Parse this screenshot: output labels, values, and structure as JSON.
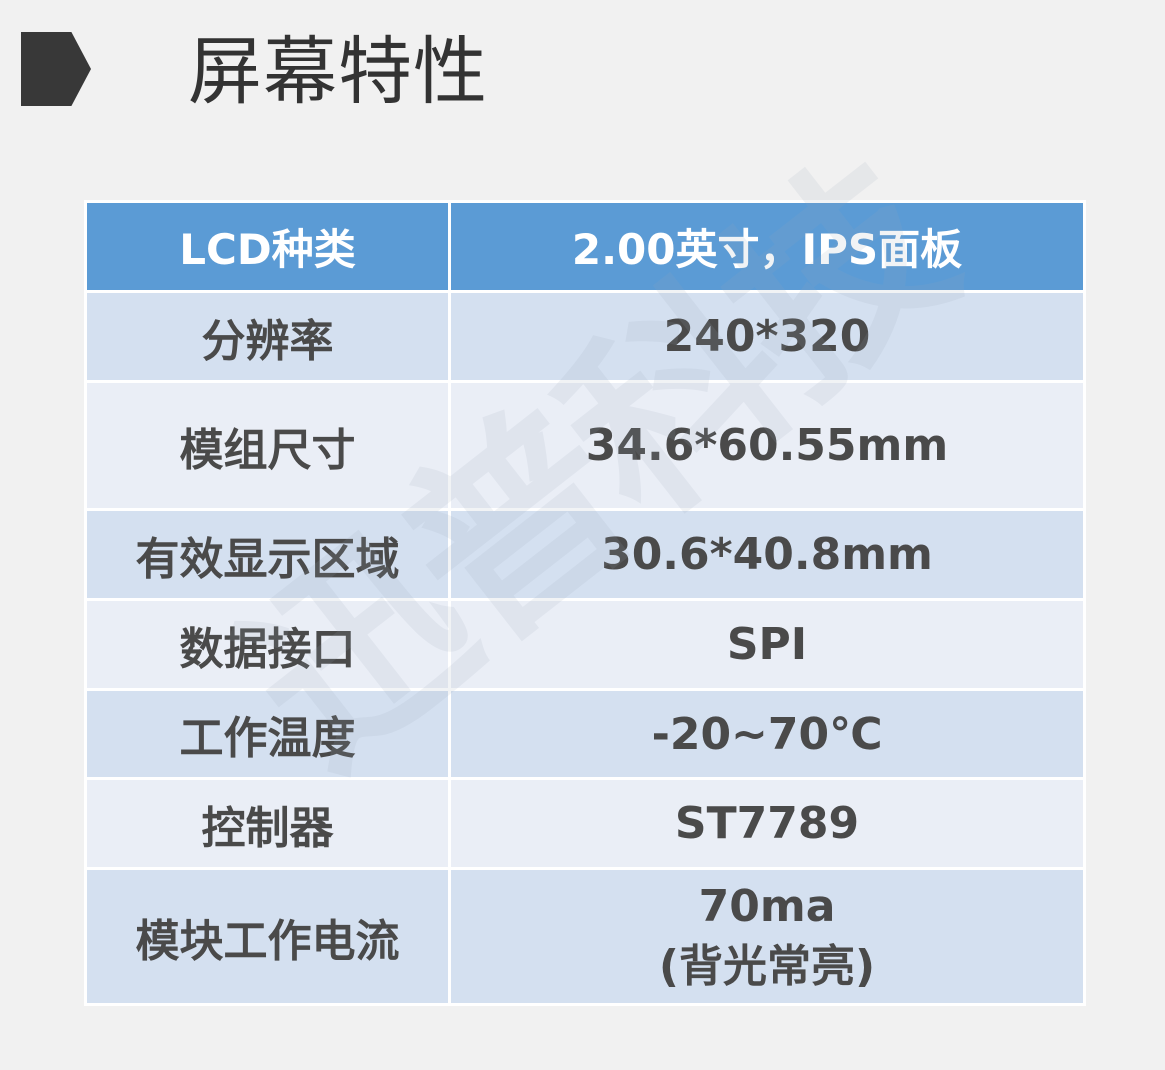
{
  "page": {
    "title": "屏幕特性"
  },
  "table": {
    "header": {
      "label": "LCD种类",
      "value": "2.00英寸，IPS面板"
    },
    "rows": [
      {
        "label": "分辨率",
        "value": "240*320"
      },
      {
        "label": "模组尺寸",
        "value": "34.6*60.55mm"
      },
      {
        "label": "有效显示区域",
        "value": "30.6*40.8mm"
      },
      {
        "label": "数据接口",
        "value": "SPI"
      },
      {
        "label": "工作温度",
        "value": "-20~70℃"
      },
      {
        "label": "控制器",
        "value": "ST7789"
      },
      {
        "label": "模块工作电流",
        "value_line1": "70ma",
        "value_line2": "(背光常亮)"
      }
    ]
  },
  "watermark": {
    "text": "迅普科技"
  },
  "colors": {
    "background": "#f1f1f1",
    "header_bg": "#5b9bd5",
    "row_dark": "#d4e0f0",
    "row_light": "#eaeef6",
    "text": "#4a4a4a",
    "marker": "#383838"
  }
}
